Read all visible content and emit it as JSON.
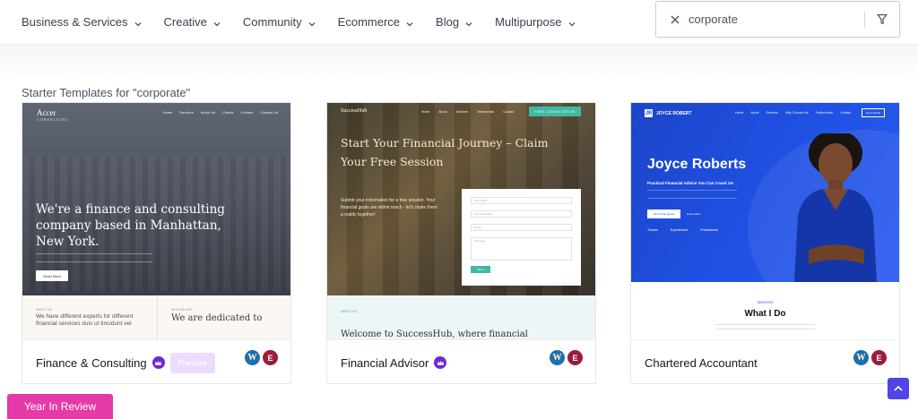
{
  "nav": {
    "items": [
      {
        "label": "Business & Services"
      },
      {
        "label": "Creative"
      },
      {
        "label": "Community"
      },
      {
        "label": "Ecommerce"
      },
      {
        "label": "Blog"
      },
      {
        "label": "Multipurpose"
      }
    ]
  },
  "search": {
    "value": "corporate"
  },
  "results": {
    "heading": "Starter Templates for \"corporate\""
  },
  "cards": [
    {
      "title": "Finance & Consulting",
      "premium": true,
      "premium_tooltip": "Premium",
      "preview": {
        "logo": "Accer",
        "logo_sub": "CONSULTING",
        "menu": [
          "Home",
          "Services",
          "About Us",
          "Clients",
          "Contact",
          "Contact Us"
        ],
        "headline": "We're a finance and consulting company based in Manhattan, New York.",
        "button": "Read More",
        "about_label": "ABOUT US",
        "about_text": "We have different experts for different financial services duis ut tincidunt vel",
        "right_label": "WHO WE ARE",
        "right_text": "We are dedicated to"
      }
    },
    {
      "title": "Financial Advisor",
      "premium": true,
      "preview": {
        "logo": "SuccessHub",
        "menu": [
          "Home",
          "About",
          "Services",
          "Testimonials",
          "Contact"
        ],
        "cta": "FREE CONSULTATION",
        "headline": "Start Your Financial Journey – Claim Your Free Session",
        "text": "Submit your information for a free session. Your financial goals are within reach - let's make them a reality together!",
        "form_fields": [
          "First Name",
          "Phone Number",
          "Email",
          "Message"
        ],
        "form_button": "Send",
        "low_label": "ABOUT US",
        "low_text": "Welcome to SuccessHub, where financial"
      }
    },
    {
      "title": "Chartered Accountant",
      "premium": false,
      "preview": {
        "logo": "JOYCE ROBERT",
        "logo_mark": "JR",
        "menu": [
          "Home",
          "About",
          "Services",
          "Why Choose Me",
          "Testimonials",
          "Contact"
        ],
        "cta": "Get A Quote",
        "name": "Joyce Roberts",
        "tagline": "Practical Financial Advice You Can Count On",
        "button1": "Get A Free Quote",
        "button2": "Learn More",
        "checks": [
          "Trusted",
          "Experienced",
          "Professional"
        ],
        "low_label": "SERVICES",
        "low_title": "What I Do"
      }
    }
  ],
  "floating": {
    "year_in_review": "Year In Review"
  },
  "colors": {
    "accent": "#4f46e5",
    "premium_crown": "#6d28d9",
    "year_in_review_bg": "#e63aa8",
    "wordpress_blue": "#1f6faa",
    "elementor_red": "#9b1c3a"
  }
}
